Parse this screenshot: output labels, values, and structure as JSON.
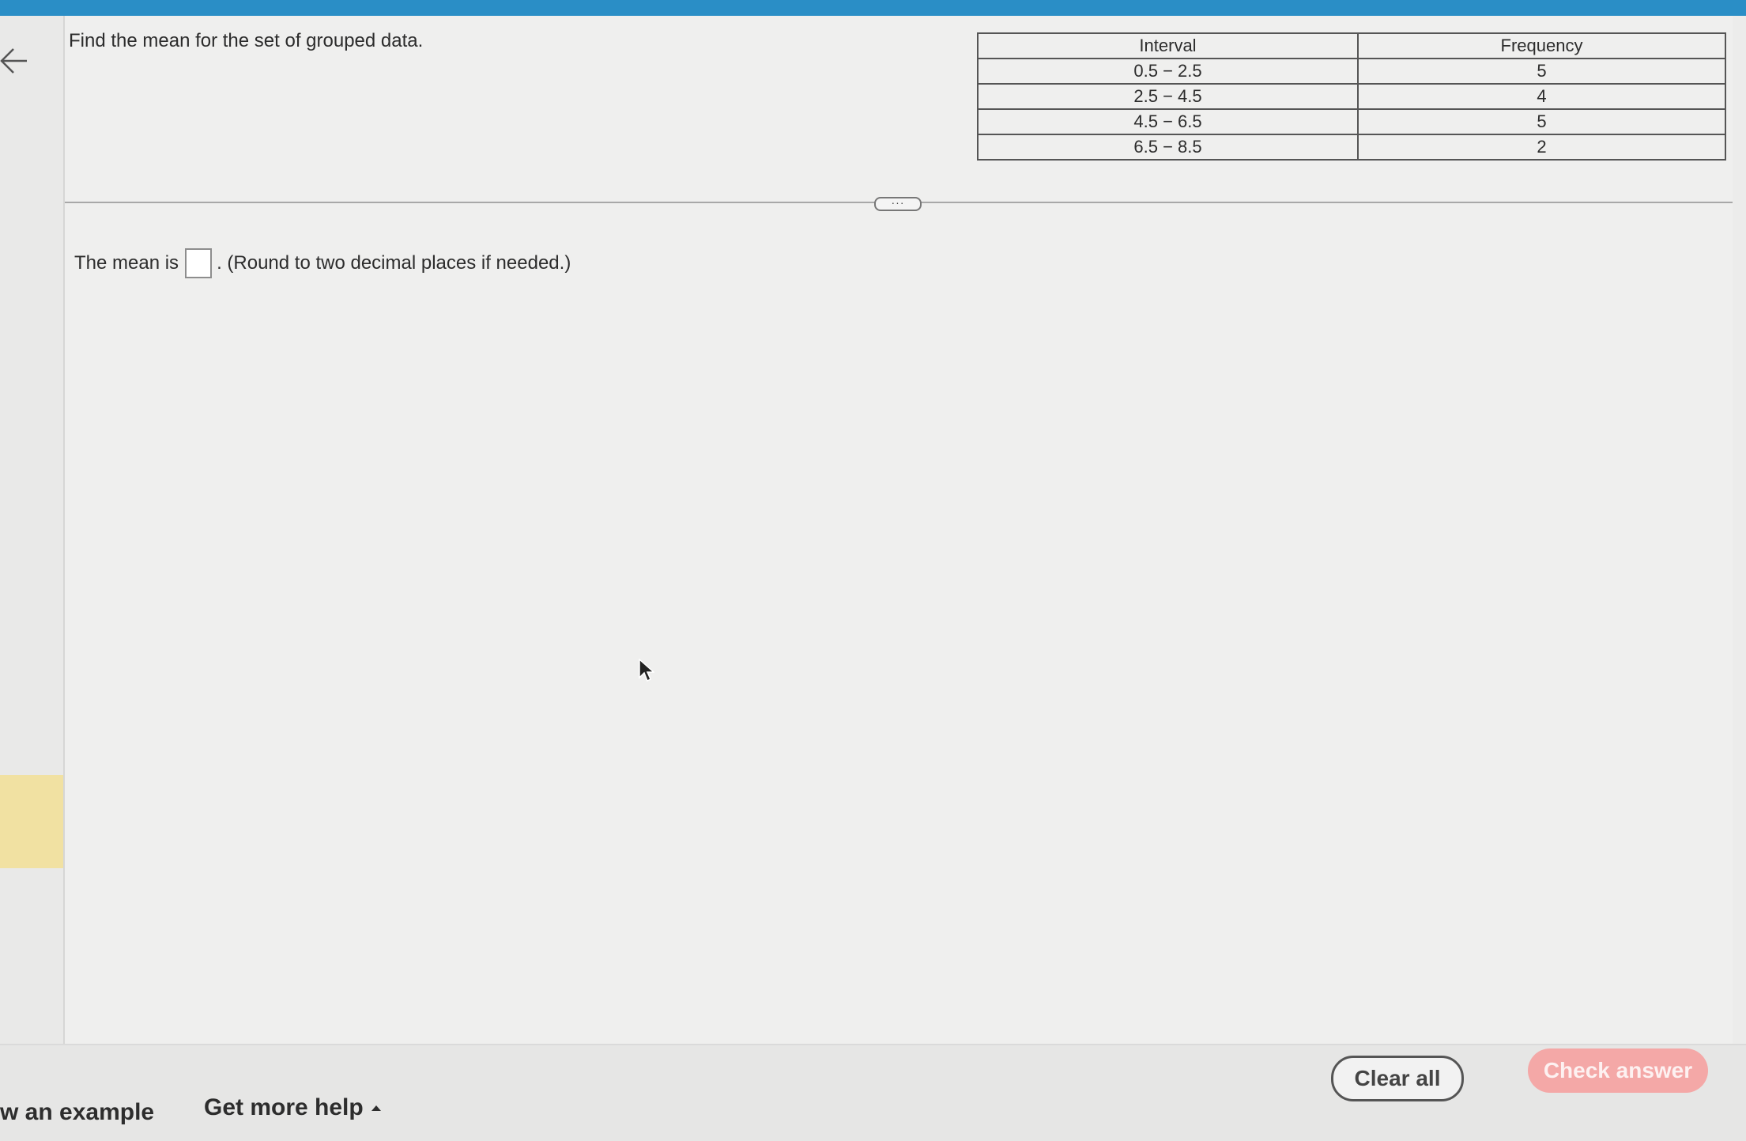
{
  "question": {
    "prompt": "Find the mean for the set of grouped data."
  },
  "table": {
    "headers": [
      "Interval",
      "Frequency"
    ],
    "rows": [
      [
        "0.5 − 2.5",
        "5"
      ],
      [
        "2.5 − 4.5",
        "4"
      ],
      [
        "4.5 − 6.5",
        "5"
      ],
      [
        "6.5 − 8.5",
        "2"
      ]
    ]
  },
  "answer": {
    "prefix": "The mean is",
    "value": "",
    "suffix": ". (Round to two decimal places if needed.)"
  },
  "more_toggle": {
    "label": "···"
  },
  "footer": {
    "example_label": "w an example",
    "help_label": "Get more help",
    "clear_label": "Clear all",
    "check_label": "Check answer"
  },
  "colors": {
    "header_bar": "#2a8ec6",
    "check_button": "#f4a8a7",
    "left_highlight": "#f1e1a2"
  },
  "icons": [
    "back-arrow-icon",
    "caret-up-icon",
    "mouse-cursor-icon"
  ]
}
